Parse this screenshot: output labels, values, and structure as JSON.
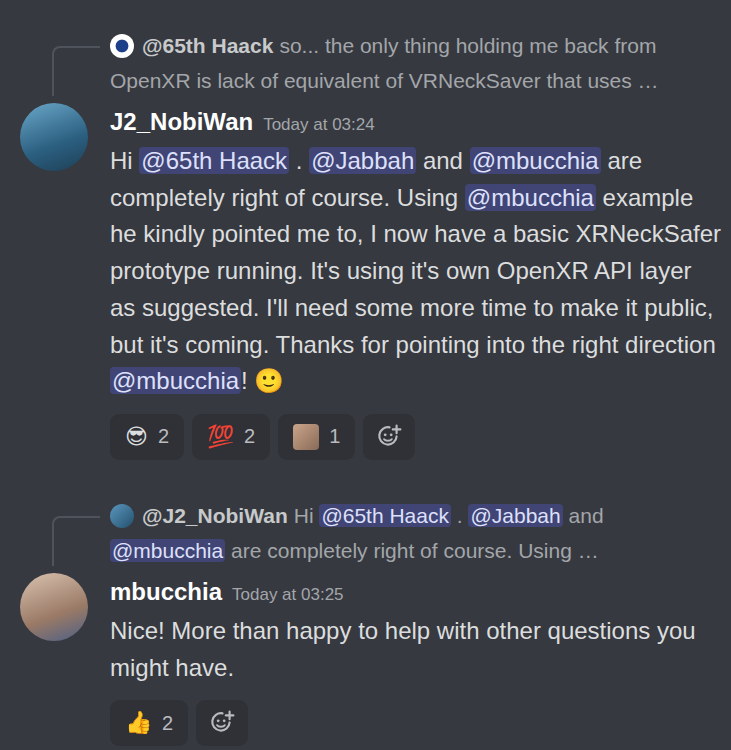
{
  "messages": [
    {
      "reply": {
        "author": "@65th Haack",
        "segments": [
          {
            "kind": "text",
            "text": "so... the only thing holding me back from OpenXR is lack of equivalent of VRNeckSaver that uses …"
          }
        ]
      },
      "author": "J2_NobiWan",
      "timestamp": "Today at 03:24",
      "content": [
        {
          "kind": "text",
          "text": "Hi "
        },
        {
          "kind": "mention",
          "text": "@65th Haack"
        },
        {
          "kind": "text",
          "text": " . "
        },
        {
          "kind": "mention",
          "text": "@Jabbah"
        },
        {
          "kind": "text",
          "text": " and "
        },
        {
          "kind": "mention",
          "text": "@mbucchia"
        },
        {
          "kind": "text",
          "text": " are completely right of course. Using "
        },
        {
          "kind": "mention",
          "text": "@mbucchia"
        },
        {
          "kind": "text",
          "text": " example he kindly pointed me to, I now have a basic XRNeckSafer prototype running. It's using it's own OpenXR API layer as suggested. I'll need some more time to make it public, but it's coming. Thanks for pointing into the right direction "
        },
        {
          "kind": "mention",
          "text": "@mbucchia"
        },
        {
          "kind": "text",
          "text": "! "
        },
        {
          "kind": "emoji",
          "text": "🙂"
        }
      ],
      "reactions": [
        {
          "kind": "emoji",
          "emoji": "😎",
          "count": "2",
          "selected": false
        },
        {
          "kind": "emoji",
          "emoji": "💯",
          "count": "2",
          "selected": false
        },
        {
          "kind": "image",
          "count": "1",
          "selected": false
        }
      ]
    },
    {
      "reply": {
        "author": "@J2_NobiWan",
        "segments": [
          {
            "kind": "text",
            "text": "Hi "
          },
          {
            "kind": "mention",
            "text": "@65th Haack"
          },
          {
            "kind": "text",
            "text": " . "
          },
          {
            "kind": "mention",
            "text": "@Jabbah"
          },
          {
            "kind": "text",
            "text": " and "
          },
          {
            "kind": "mention",
            "text": "@mbucchia"
          },
          {
            "kind": "text",
            "text": " are completely right of course. Using …"
          }
        ]
      },
      "author": "mbucchia",
      "timestamp": "Today at 03:25",
      "content": [
        {
          "kind": "text",
          "text": "Nice! More than happy to help with other questions you might have."
        }
      ],
      "reactions": [
        {
          "kind": "emoji",
          "emoji": "👍",
          "count": "2",
          "selected": false
        }
      ]
    }
  ]
}
